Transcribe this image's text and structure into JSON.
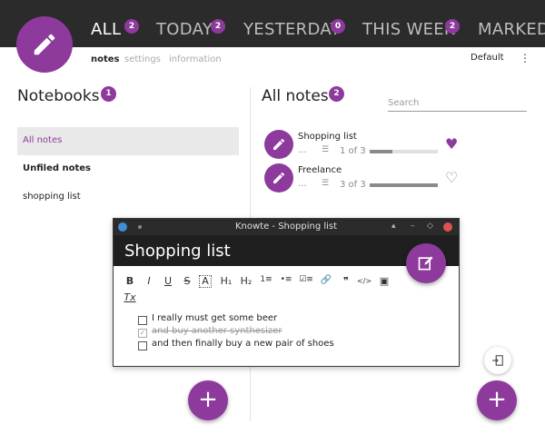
{
  "tabs": [
    {
      "label": "ALL",
      "count": "2"
    },
    {
      "label": "TODAY",
      "count": "2"
    },
    {
      "label": "YESTERDAY",
      "count": "0"
    },
    {
      "label": "THIS WEEK",
      "count": "2"
    },
    {
      "label": "MARKED"
    }
  ],
  "subnav": {
    "notes": "notes",
    "settings": "settings",
    "information": "information"
  },
  "sort_label": "Default",
  "menu_glyph": "⋮",
  "notebooks": {
    "title": "Notebooks",
    "count": "1",
    "items": [
      "All notes",
      "Unfiled notes",
      "shopping list"
    ]
  },
  "all_notes": {
    "title": "All notes",
    "count": "2",
    "search_placeholder": "Search",
    "notes": [
      {
        "title": "Shopping list",
        "dots": "...",
        "progress": "1 of 3",
        "progress_value": 0.33,
        "favorite": true
      },
      {
        "title": "Freelance",
        "dots": "...",
        "progress": "3 of 3",
        "progress_value": 1.0,
        "favorite": false
      }
    ]
  },
  "editor": {
    "window_title": "Knowte - Shopping list",
    "heading": "Shopping list",
    "toolbar": [
      "B",
      "I",
      "U",
      "S",
      "A",
      "H₁",
      "H₂",
      "1≡",
      "•≡",
      "☑≡",
      "🔗",
      "❞",
      "</>",
      "▣"
    ],
    "clear_format": "Tx",
    "checklist": [
      {
        "text": "I really must get some beer",
        "checked": false
      },
      {
        "text": "and buy another synthesizer",
        "checked": true
      },
      {
        "text": "and then finally buy a new pair of shoes",
        "checked": false
      }
    ]
  },
  "fab_label": "+",
  "colors": {
    "accent": "#8e3a9d",
    "topbar": "#2b2b2b"
  }
}
